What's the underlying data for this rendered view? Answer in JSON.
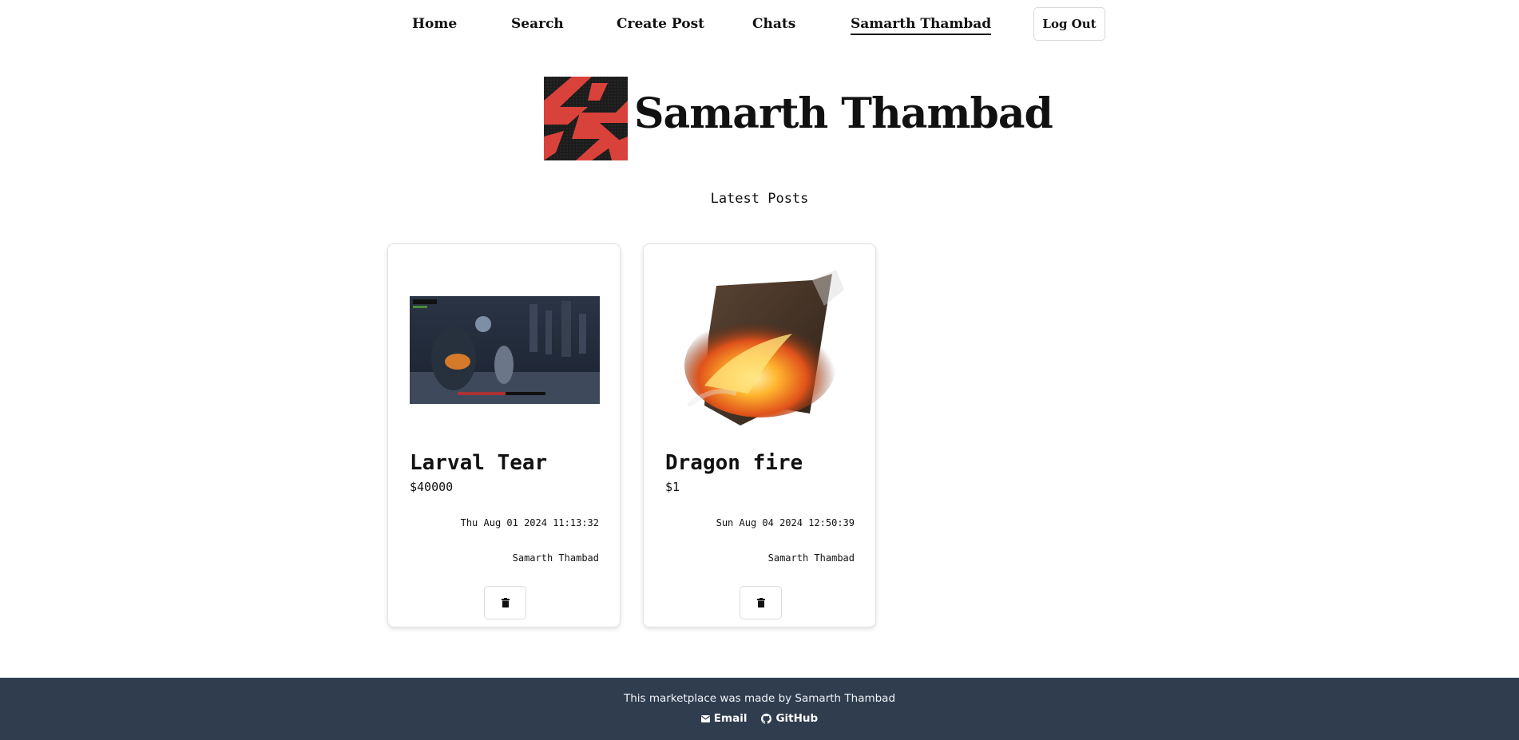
{
  "nav": {
    "items": [
      {
        "label": "Home"
      },
      {
        "label": "Search"
      },
      {
        "label": "Create Post"
      },
      {
        "label": "Chats"
      },
      {
        "label": "Samarth Thambad"
      }
    ],
    "logout_label": "Log Out"
  },
  "profile": {
    "name": "Samarth Thambad",
    "logo_icon": "brand-logo-icon",
    "logo_colors": {
      "background": "#1c1c1c",
      "accent": "#d9423a"
    }
  },
  "section_title": "Latest Posts",
  "posts": [
    {
      "title": "Larval Tear",
      "price": "$40000",
      "date": "Thu Aug 01 2024 11:13:32",
      "author": "Samarth Thambad",
      "image": "game-screenshot"
    },
    {
      "title": "Dragon fire",
      "price": "$1",
      "date": "Sun Aug 04 2024 12:50:39",
      "author": "Samarth Thambad",
      "image": "dragon-fire-scroll"
    }
  ],
  "footer": {
    "text": "This marketplace was made by Samarth Thambad",
    "email_label": "Email",
    "github_label": "GitHub",
    "background": "#2f3d4f"
  }
}
